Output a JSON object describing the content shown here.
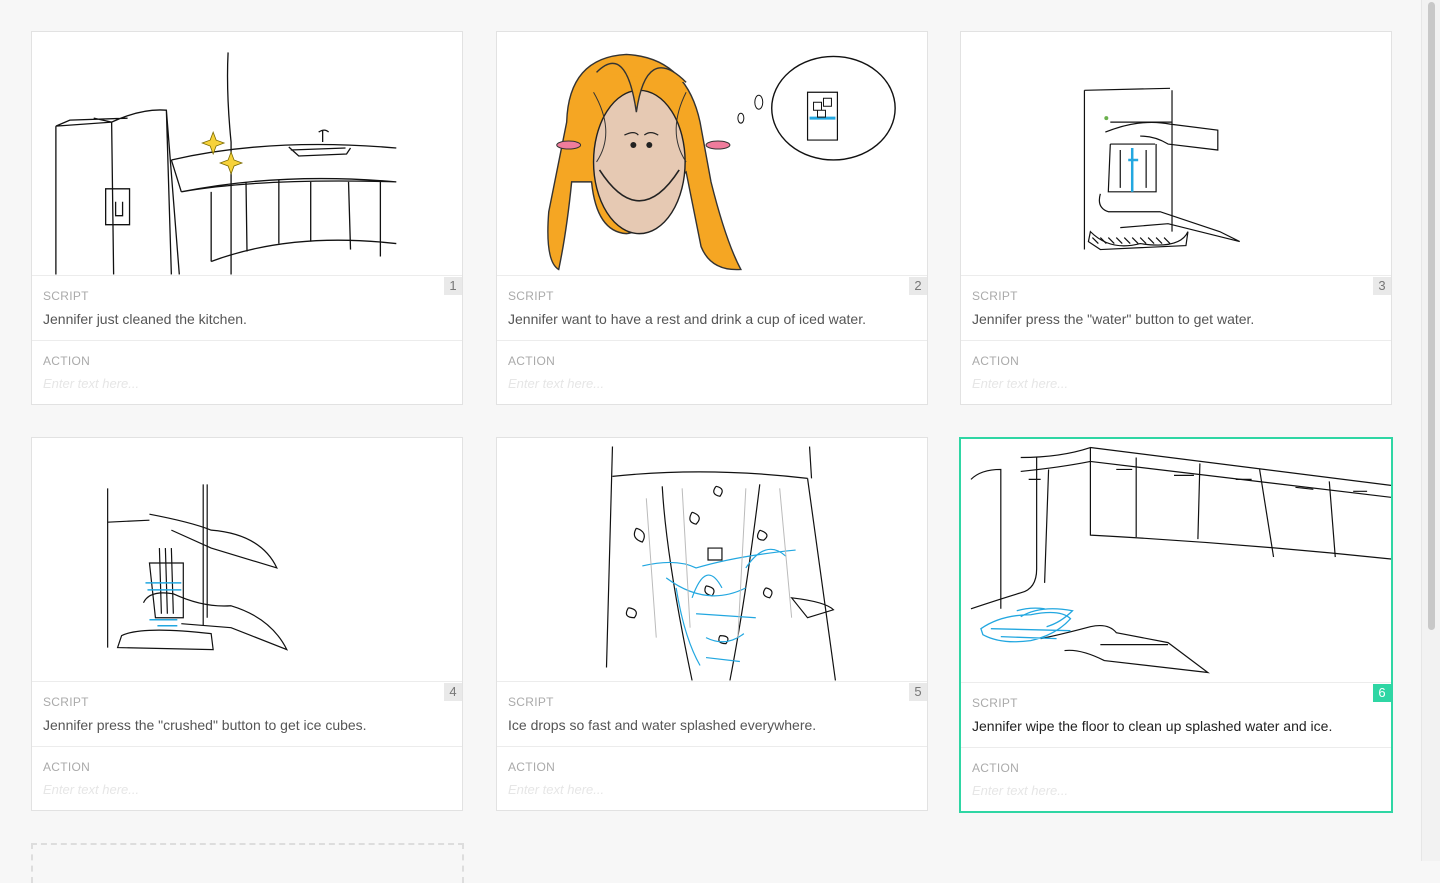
{
  "board": {
    "labels": {
      "script": "SCRIPT",
      "action": "ACTION",
      "placeholder": "Enter text here..."
    },
    "accent_color": "#2fd6a4",
    "active_frame": 6,
    "frames": [
      {
        "number": "1",
        "script": "Jennifer just cleaned the kitchen.",
        "action": "",
        "image": "kitchen-sketch"
      },
      {
        "number": "2",
        "script": "Jennifer want to have a rest and drink a cup of iced water.",
        "action": "",
        "image": "girl-thinking-sketch"
      },
      {
        "number": "3",
        "script": "Jennifer press the \"water\" button to get water.",
        "action": "",
        "image": "water-dispenser-sketch"
      },
      {
        "number": "4",
        "script": "Jennifer press the \"crushed\" button to get ice cubes.",
        "action": "",
        "image": "ice-dispenser-sketch"
      },
      {
        "number": "5",
        "script": "Ice drops so fast and water splashed everywhere.",
        "action": "",
        "image": "ice-splash-sketch"
      },
      {
        "number": "6",
        "script": "Jennifer wipe the floor to clean up splashed water and ice.",
        "action": "",
        "image": "wipe-floor-sketch"
      }
    ]
  }
}
